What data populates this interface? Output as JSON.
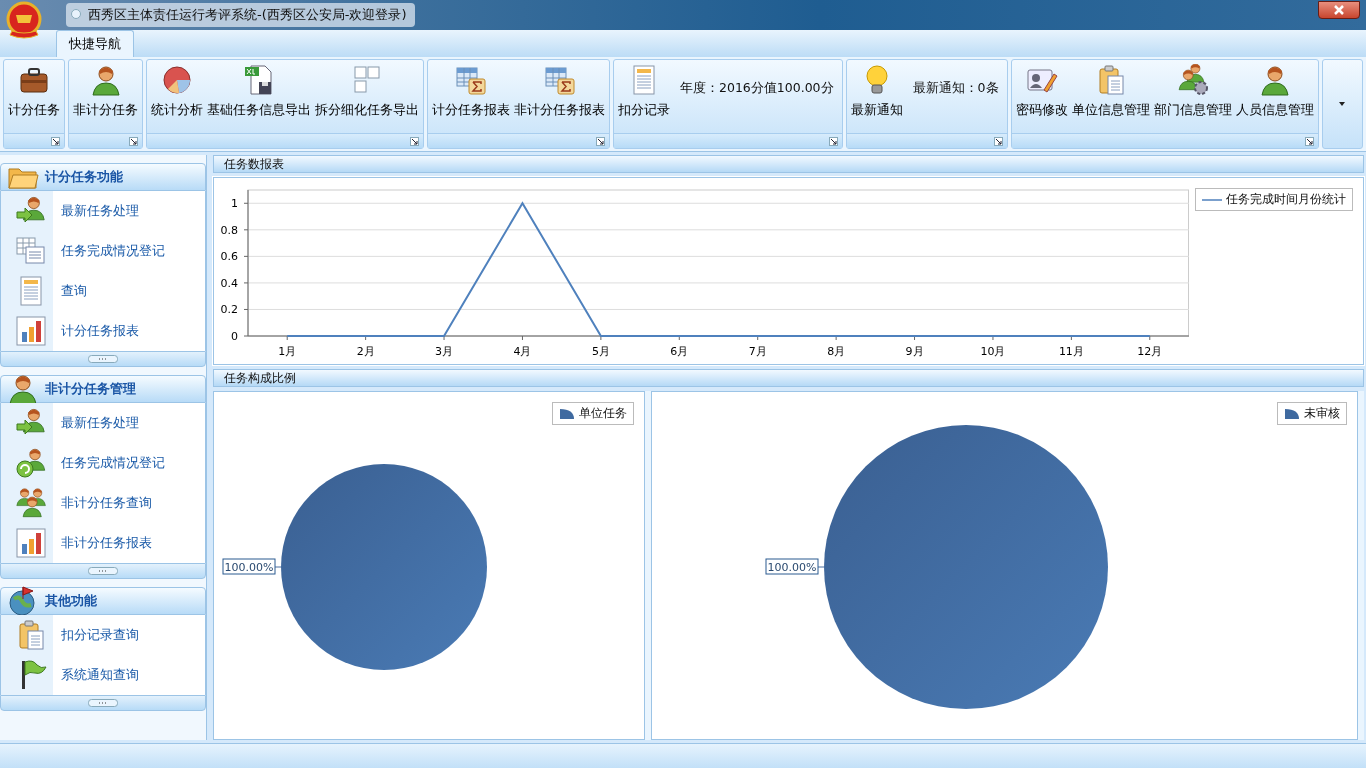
{
  "window": {
    "title": "西秀区主体责任运行考评系统-(西秀区公安局-欢迎登录)"
  },
  "tabs": [
    {
      "label": "快捷导航",
      "selected": true
    }
  ],
  "ribbon": {
    "groups": [
      {
        "buttons": [
          "计分任务"
        ]
      },
      {
        "buttons": [
          "非计分任务"
        ]
      },
      {
        "buttons": [
          "统计分析",
          "基础任务信息导出",
          "拆分细化任务导出"
        ]
      },
      {
        "buttons": [
          "计分任务报表",
          "非计分任务报表"
        ]
      },
      {
        "buttons": [
          "扣分记录"
        ],
        "info": "年度：2016分值100.00分"
      },
      {
        "buttons": [
          "最新通知"
        ],
        "info": "最新通知：0条"
      },
      {
        "buttons": [
          "密码修改",
          "单位信息管理",
          "部门信息管理",
          "人员信息管理"
        ]
      }
    ]
  },
  "sidebar": {
    "sections": [
      {
        "title": "计分任务功能",
        "items": [
          "最新任务处理",
          "任务完成情况登记",
          "查询",
          "计分任务报表"
        ]
      },
      {
        "title": "非计分任务管理",
        "items": [
          "最新任务处理",
          "任务完成情况登记",
          "非计分任务查询",
          "非计分任务报表"
        ]
      },
      {
        "title": "其他功能",
        "items": [
          "扣分记录查询",
          "系统通知查询"
        ]
      }
    ]
  },
  "report_panel": {
    "title": "任务数报表",
    "chart_data": {
      "type": "line",
      "categories": [
        "1月",
        "2月",
        "3月",
        "4月",
        "5月",
        "6月",
        "7月",
        "8月",
        "9月",
        "10月",
        "11月",
        "12月"
      ],
      "series": [
        {
          "name": "任务完成时间月份统计",
          "color": "#4f81bd",
          "values": [
            0,
            0,
            0,
            1,
            0,
            0,
            0,
            0,
            0,
            0,
            0,
            0
          ]
        }
      ],
      "ylim": [
        0,
        1.1
      ],
      "grid": true,
      "yticks": [
        0,
        {
          "value": 0.2,
          "label": "0.2"
        },
        {
          "value": 0.4,
          "label": "0.4"
        },
        {
          "value": 0.6,
          "label": "0.6"
        },
        {
          "value": 0.8,
          "label": "0.8"
        },
        1
      ]
    }
  },
  "composition_panel": {
    "title": "任务构成比例",
    "charts": [
      {
        "chart_data": {
          "type": "pie",
          "categories": [
            "单位任务"
          ],
          "values": [
            100
          ],
          "value_labels": [
            "100.00%"
          ]
        }
      },
      {
        "chart_data": {
          "type": "pie",
          "categories": [
            "未审核"
          ],
          "values": [
            100
          ],
          "value_labels": [
            "100.00%"
          ]
        }
      }
    ]
  }
}
